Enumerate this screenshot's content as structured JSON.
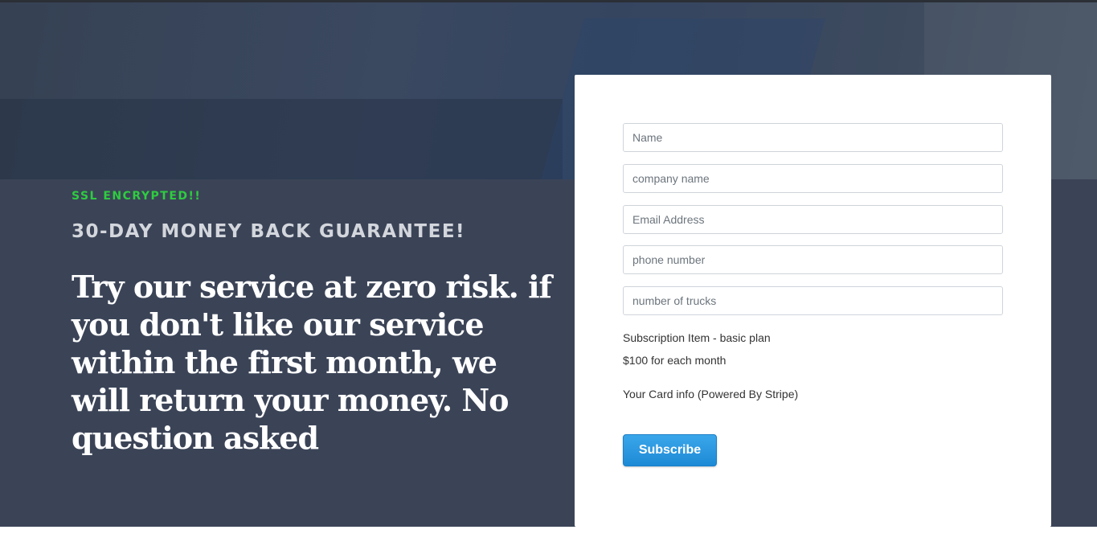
{
  "hero": {
    "ssl_label": "SSL ENCRYPTED!!",
    "guarantee": "30-DAY MONEY BACK GUARANTEE!",
    "pitch": "Try our service at zero risk. if you don't like our service within the first month, we will return your money. No question asked"
  },
  "form": {
    "name_placeholder": "Name",
    "company_placeholder": "company name",
    "email_placeholder": "Email Address",
    "phone_placeholder": "phone number",
    "trucks_placeholder": "number of trucks",
    "subscription_item": "Subscription Item - basic plan",
    "price": "$100 for each month",
    "card_info": "Your Card info (Powered By Stripe)",
    "subscribe_label": "Subscribe"
  },
  "colors": {
    "hero_bg": "#3b4457",
    "ssl_green": "#2ecc40",
    "button_blue": "#2596e0"
  }
}
